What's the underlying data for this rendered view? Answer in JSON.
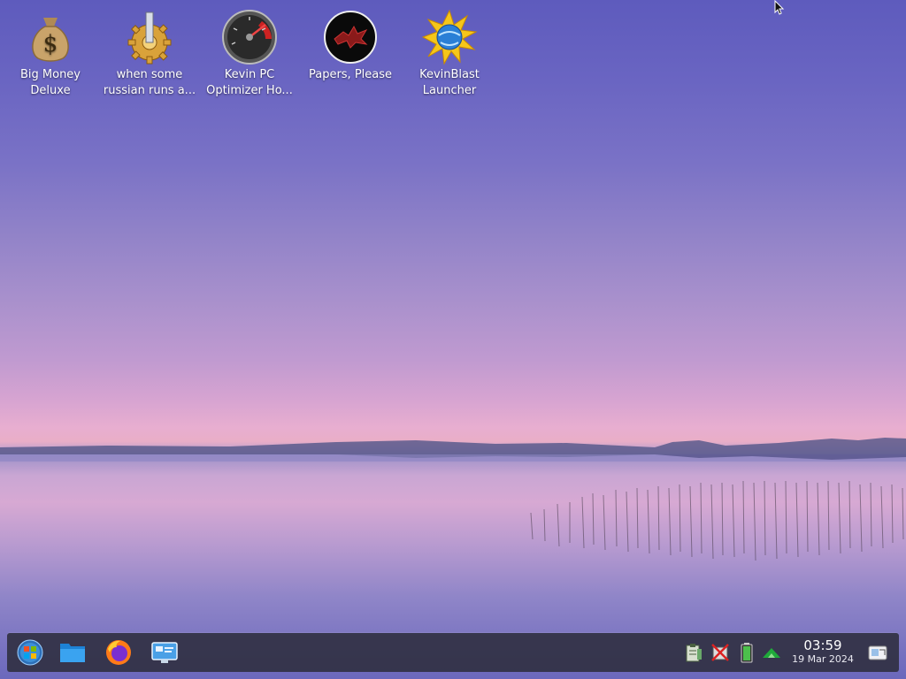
{
  "desktop_icons": [
    {
      "label": "Big Money\nDeluxe",
      "icon": "money-bag-icon"
    },
    {
      "label": "when some\nrussian runs a...",
      "icon": "gear-icon"
    },
    {
      "label": "Kevin PC\nOptimizer Ho...",
      "icon": "speedometer-icon"
    },
    {
      "label": "Papers, Please",
      "icon": "eagle-emblem-icon"
    },
    {
      "label": "KevinBlast\nLauncher",
      "icon": "globe-burst-icon"
    }
  ],
  "taskbar": {
    "launchers": [
      {
        "icon": "start-menu-icon"
      },
      {
        "icon": "file-manager-icon"
      },
      {
        "icon": "firefox-icon"
      },
      {
        "icon": "system-settings-icon"
      }
    ],
    "tray": [
      {
        "icon": "clipboard-icon"
      },
      {
        "icon": "network-disconnected-icon"
      },
      {
        "icon": "battery-icon"
      },
      {
        "icon": "update-notifier-icon"
      }
    ],
    "clock": {
      "time": "03:59",
      "date": "19 Mar 2024"
    },
    "show_desktop": {
      "icon": "show-desktop-icon"
    }
  }
}
